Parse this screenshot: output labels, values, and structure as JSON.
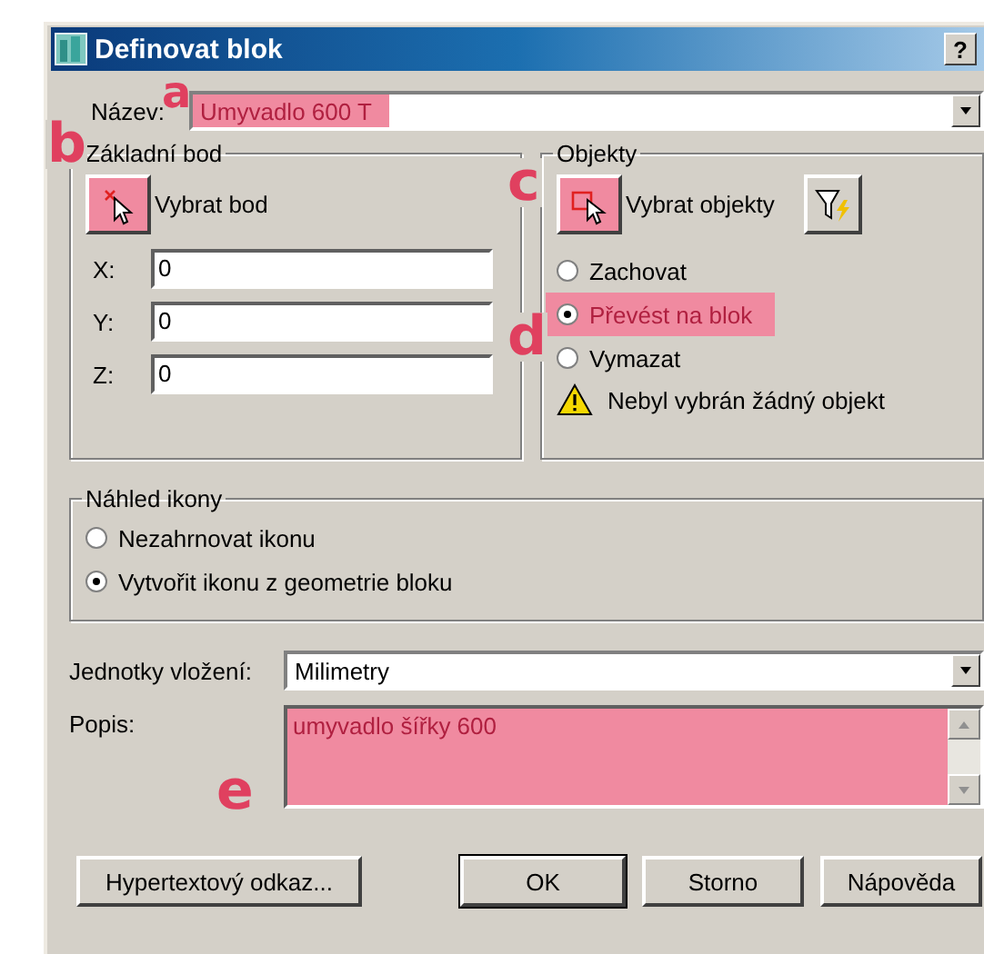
{
  "window": {
    "title": "Definovat blok",
    "help_button": "?"
  },
  "name": {
    "label": "Název:",
    "value": "Umyvadlo 600 T",
    "highlighted": true
  },
  "base_point": {
    "title": "Základní bod",
    "pick_button": {
      "label": "Vybrat bod",
      "highlighted": true
    },
    "coords": [
      {
        "label": "X:",
        "value": "0"
      },
      {
        "label": "Y:",
        "value": "0"
      },
      {
        "label": "Z:",
        "value": "0"
      }
    ]
  },
  "objects": {
    "title": "Objekty",
    "select_button": {
      "label": "Vybrat objekty",
      "highlighted": true
    },
    "options": [
      {
        "label": "Zachovat",
        "selected": false,
        "highlighted": false
      },
      {
        "label": "Převést na blok",
        "selected": true,
        "highlighted": true
      },
      {
        "label": "Vymazat",
        "selected": false,
        "highlighted": false
      }
    ],
    "warning": "Nebyl vybrán žádný objekt"
  },
  "icon_preview": {
    "title": "Náhled ikony",
    "options": [
      {
        "label": "Nezahrnovat ikonu",
        "selected": false
      },
      {
        "label": "Vytvořit ikonu z geometrie bloku",
        "selected": true
      }
    ]
  },
  "units": {
    "label": "Jednotky vložení:",
    "value": "Milimetry"
  },
  "description": {
    "label": "Popis:",
    "value": "umyvadlo šířky 600",
    "highlighted": true
  },
  "buttons": [
    {
      "label": "Hypertextový odkaz...",
      "default": false
    },
    {
      "label": "OK",
      "default": true
    },
    {
      "label": "Storno",
      "default": false
    },
    {
      "label": "Nápověda",
      "default": false
    }
  ],
  "annotations": [
    {
      "letter": "a"
    },
    {
      "letter": "b"
    },
    {
      "letter": "c"
    },
    {
      "letter": "d"
    },
    {
      "letter": "e"
    }
  ]
}
